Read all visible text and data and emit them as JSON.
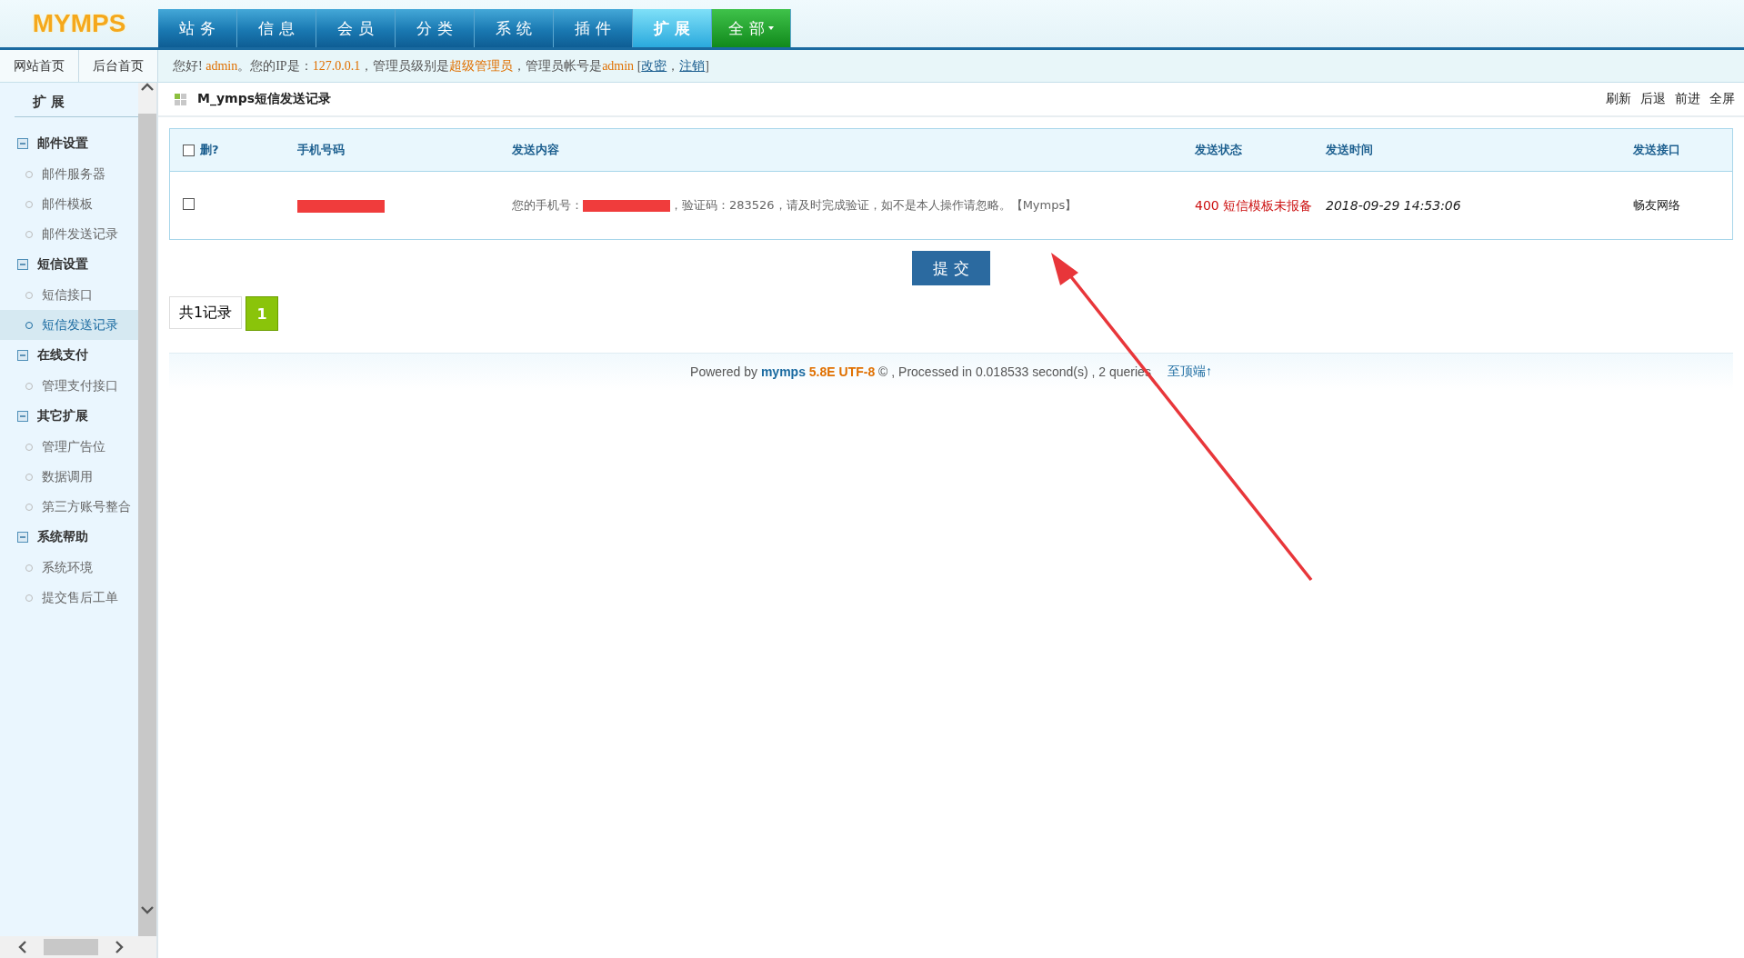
{
  "logo": "MYMPS",
  "nav_tabs": [
    {
      "label": "站 务",
      "selected": false,
      "kind": "tab"
    },
    {
      "label": "信 息",
      "selected": false,
      "kind": "tab"
    },
    {
      "label": "会 员",
      "selected": false,
      "kind": "tab"
    },
    {
      "label": "分 类",
      "selected": false,
      "kind": "tab"
    },
    {
      "label": "系 统",
      "selected": false,
      "kind": "tab"
    },
    {
      "label": "插 件",
      "selected": false,
      "kind": "tab"
    },
    {
      "label": "扩 展",
      "selected": true,
      "kind": "tab"
    },
    {
      "label": "全 部",
      "selected": false,
      "kind": "dropdown"
    }
  ],
  "quick_links": [
    "网站首页",
    "后台首页"
  ],
  "greeting": [
    {
      "kind": "text",
      "text": "您好! "
    },
    {
      "kind": "highlight",
      "text": "admin"
    },
    {
      "kind": "text",
      "text": "。您的IP是："
    },
    {
      "kind": "highlight",
      "text": "127.0.0.1"
    },
    {
      "kind": "text",
      "text": "，管理员级别是"
    },
    {
      "kind": "highlight",
      "text": "超级管理员"
    },
    {
      "kind": "text",
      "text": "，管理员帐号是"
    },
    {
      "kind": "highlight",
      "text": "admin"
    },
    {
      "kind": "text",
      "text": " ["
    },
    {
      "kind": "link",
      "text": "改密"
    },
    {
      "kind": "text",
      "text": "，"
    },
    {
      "kind": "link",
      "text": "注销"
    },
    {
      "kind": "text",
      "text": "]"
    }
  ],
  "sidebar": {
    "title": "扩 展",
    "groups": [
      {
        "label": "邮件设置",
        "expanded": true,
        "children": [
          {
            "label": "邮件服务器",
            "selected": false
          },
          {
            "label": "邮件模板",
            "selected": false
          },
          {
            "label": "邮件发送记录",
            "selected": false
          }
        ]
      },
      {
        "label": "短信设置",
        "expanded": true,
        "children": [
          {
            "label": "短信接口",
            "selected": false
          },
          {
            "label": "短信发送记录",
            "selected": true
          }
        ]
      },
      {
        "label": "在线支付",
        "expanded": true,
        "children": [
          {
            "label": "管理支付接口",
            "selected": false
          }
        ]
      },
      {
        "label": "其它扩展",
        "expanded": true,
        "children": [
          {
            "label": "管理广告位",
            "selected": false
          },
          {
            "label": "数据调用",
            "selected": false
          },
          {
            "label": "第三方账号整合",
            "selected": false
          }
        ]
      },
      {
        "label": "系统帮助",
        "expanded": true,
        "children": [
          {
            "label": "系统环境",
            "selected": false
          },
          {
            "label": "提交售后工单",
            "selected": false
          }
        ]
      }
    ]
  },
  "page_title": "M_ymps短信发送记录",
  "toolbar": [
    "刷新",
    "后退",
    "前进",
    "全屏"
  ],
  "table": {
    "columns": [
      "删?",
      "手机号码",
      "发送内容",
      "发送状态",
      "发送时间",
      "发送接口"
    ],
    "header_checked": false,
    "rows": [
      {
        "checked": false,
        "content_before": "您的手机号：",
        "content_after": "，验证码：283526，请及时完成验证，如不是本人操作请忽略。【Mymps】",
        "status": "400 短信模板未报备",
        "time": "2018-09-29 14:53:06",
        "gateway": "畅友网络"
      }
    ]
  },
  "submit_button": "提 交",
  "pagination": {
    "total": "共1记录",
    "pages": [
      {
        "label": "1",
        "selected": true
      }
    ]
  },
  "footer": {
    "prefix": "Powered by ",
    "product": "mymps",
    "version": " 5.8E UTF-8",
    "suffix": " © , Processed in 0.018533 second(s) , 2 queries",
    "top_link": "至顶端↑"
  }
}
